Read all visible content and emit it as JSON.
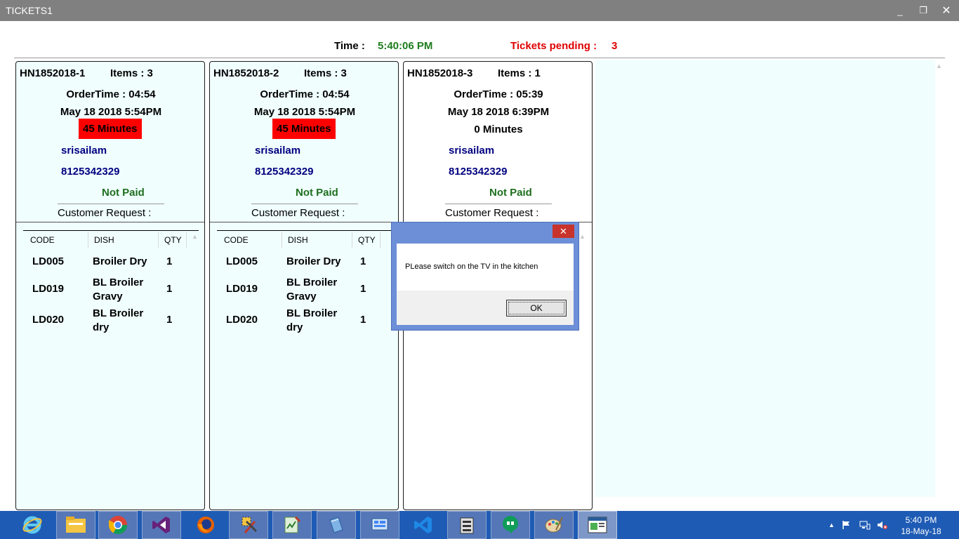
{
  "window": {
    "title": "TICKETS1",
    "minimize_glyph": "_",
    "maximize_glyph": "❐",
    "close_glyph": "✕"
  },
  "header": {
    "time_label": "Time :",
    "time_value": "5:40:06 PM",
    "pending_label": "Tickets pending :",
    "pending_value": "3"
  },
  "columns": {
    "code": "CODE",
    "dish": "DISH",
    "qty": "QTY"
  },
  "tickets": [
    {
      "id": "HN1852018-1",
      "items": "Items : 3",
      "order_time": "OrderTime : 04:54",
      "date": "May 18 2018  5:54PM",
      "duration": "45 Minutes",
      "overdue": true,
      "customer": "srisailam",
      "phone": "8125342329",
      "payment": "Not Paid",
      "request_label": "Customer Request :",
      "rows": [
        {
          "code": "LD005",
          "dish": "Broiler Dry",
          "qty": "1"
        },
        {
          "code": "LD019",
          "dish": "BL Broiler Gravy",
          "qty": "1"
        },
        {
          "code": "LD020",
          "dish": "BL Broiler dry",
          "qty": "1"
        }
      ]
    },
    {
      "id": "HN1852018-2",
      "items": "Items : 3",
      "order_time": "OrderTime : 04:54",
      "date": "May 18 2018  5:54PM",
      "duration": "45 Minutes",
      "overdue": true,
      "customer": "srisailam",
      "phone": "8125342329",
      "payment": "Not Paid",
      "request_label": "Customer Request :",
      "rows": [
        {
          "code": "LD005",
          "dish": "Broiler Dry",
          "qty": "1"
        },
        {
          "code": "LD019",
          "dish": "BL Broiler Gravy",
          "qty": "1"
        },
        {
          "code": "LD020",
          "dish": "BL Broiler dry",
          "qty": "1"
        }
      ]
    },
    {
      "id": "HN1852018-3",
      "items": "Items : 1",
      "order_time": "OrderTime : 05:39",
      "date": "May 18 2018  6:39PM",
      "duration": "0 Minutes",
      "overdue": false,
      "customer": "srisailam",
      "phone": "8125342329",
      "payment": "Not Paid",
      "request_label": "Customer Request :"
    }
  ],
  "dialog": {
    "message": "PLease switch on the TV in the kitchen",
    "ok_label": "OK",
    "close_glyph": "✕"
  },
  "taskbar": {
    "apps": [
      "internet-explorer",
      "file-explorer",
      "chrome",
      "visual-studio",
      "firefox",
      "tools",
      "notepad",
      "book",
      "control-panel",
      "vs-code",
      "archive",
      "hangouts",
      "paint",
      "tickets-app"
    ],
    "clock_time": "5:40 PM",
    "clock_date": "18-May-18"
  }
}
